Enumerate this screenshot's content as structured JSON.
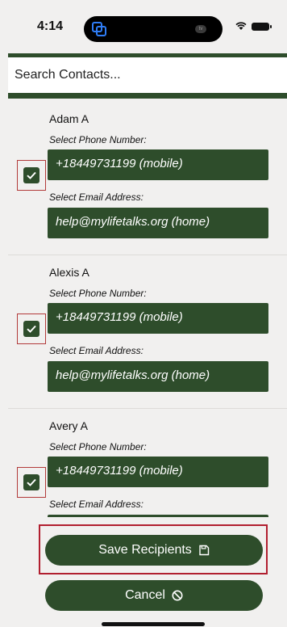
{
  "status": {
    "time": "4:14",
    "island_badge": "tv"
  },
  "search": {
    "placeholder": "Search Contacts..."
  },
  "contacts": [
    {
      "name": "Adam A",
      "phone_label": "Select Phone Number:",
      "phone": "+18449731199 (mobile)",
      "email_label": "Select Email Address:",
      "email": "help@mylifetalks.org (home)",
      "checked": true
    },
    {
      "name": "Alexis A",
      "phone_label": "Select Phone Number:",
      "phone": "+18449731199 (mobile)",
      "email_label": "Select Email Address:",
      "email": "help@mylifetalks.org (home)",
      "checked": true
    },
    {
      "name": "Avery A",
      "phone_label": "Select Phone Number:",
      "phone": "+18449731199 (mobile)",
      "email_label": "Select Email Address:",
      "email": "",
      "checked": true
    }
  ],
  "actions": {
    "save_label": "Save Recipients",
    "save_icon": "save-icon",
    "cancel_label": "Cancel",
    "cancel_icon": "cancel-icon"
  },
  "colors": {
    "accent": "#2e4d2b",
    "highlight": "#b11f2f",
    "background": "#f1f0ef"
  }
}
